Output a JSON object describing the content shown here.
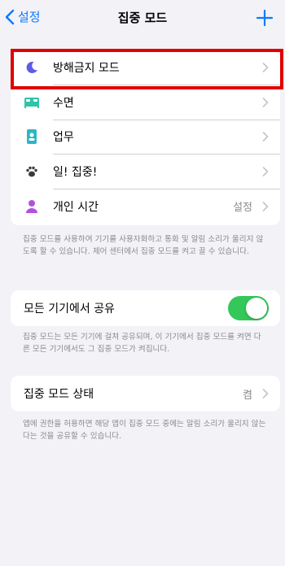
{
  "navbar": {
    "back_label": "설정",
    "title": "집중 모드",
    "add_icon": "plus-icon",
    "accent": "#0a7aff"
  },
  "focus_modes": [
    {
      "label": "방해금지 모드",
      "icon": "moon-icon",
      "color": "#5e5ce6",
      "value": ""
    },
    {
      "label": "수면",
      "icon": "bed-icon",
      "color": "#2fc4a8",
      "value": ""
    },
    {
      "label": "업무",
      "icon": "id-badge-icon",
      "color": "#2fb5c4",
      "value": ""
    },
    {
      "label": "일! 집중!",
      "icon": "paw-icon",
      "color": "#3a3a3c",
      "value": ""
    },
    {
      "label": "개인 시간",
      "icon": "person-icon",
      "color": "#af52de",
      "value": "설정"
    }
  ],
  "focus_modes_footnote": "집중 모드를 사용하여 기기를 사용자화하고 통화 및 알림 소리가 울리지 않도록 할 수 있습니다. 제어 센터에서 집중 모드를 켜고 끌 수 있습니다.",
  "share_across_devices": {
    "label": "모든 기기에서 공유",
    "enabled": true,
    "toggle_color": "#34c759"
  },
  "share_footnote": "집중 모드는 모든 기기에 걸쳐 공유되며, 이 기기에서 집중 모드를 켜면 다른 모든 기기에서도 그 집중 모드가 켜집니다.",
  "focus_status": {
    "label": "집중 모드 상태",
    "value": "켬"
  },
  "focus_status_footnote": "앱에 권한을 허용하면 해당 앱이 집중 모드 중에는 알림 소리가 울리지 않는다는 것을 공유할 수 있습니다.",
  "highlight_color": "#e00000"
}
